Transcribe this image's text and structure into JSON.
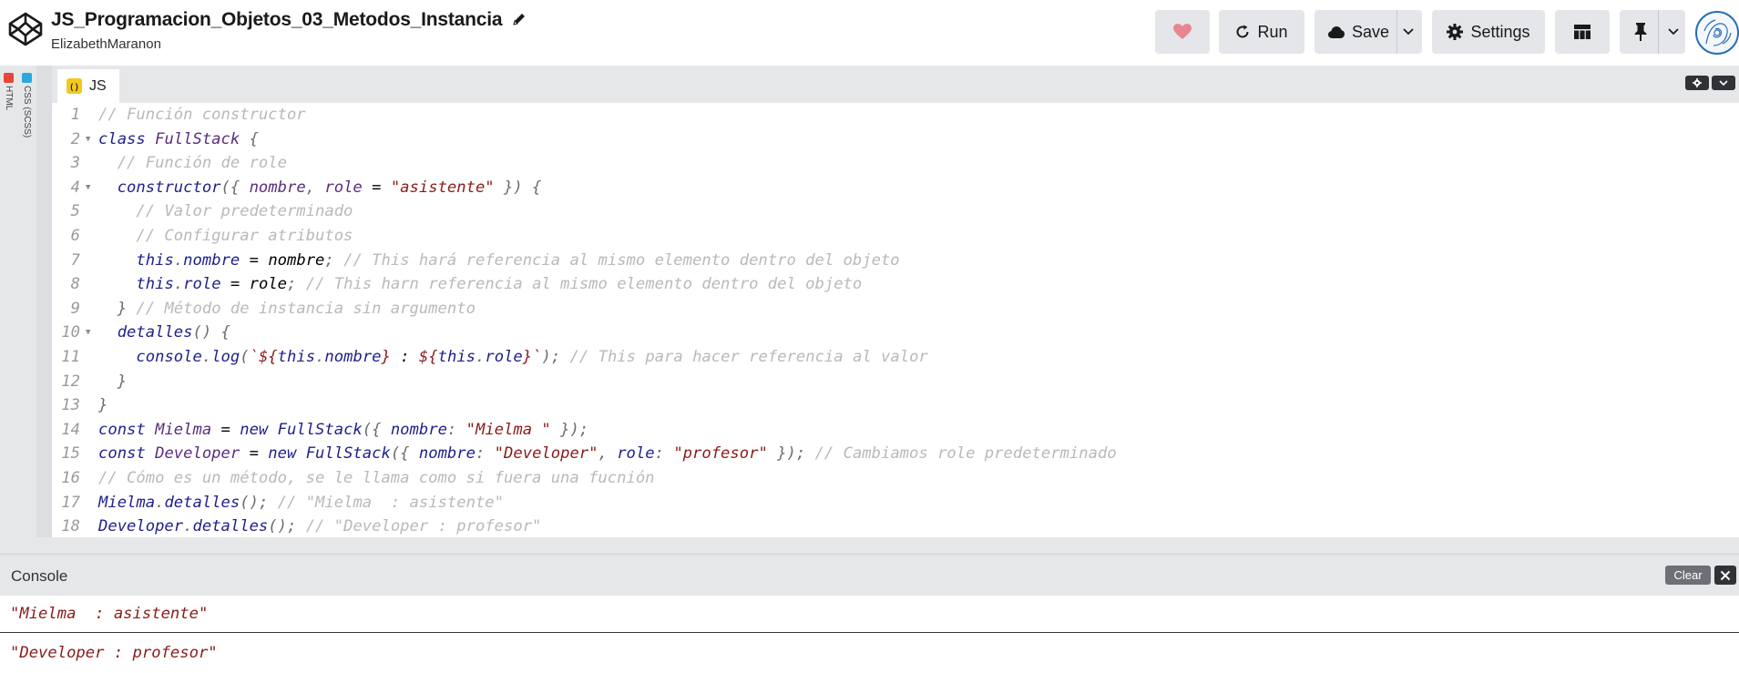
{
  "header": {
    "title": "JS_Programacion_Objetos_03_Metodos_Instancia",
    "author": "ElizabethMaranon",
    "run_label": "Run",
    "save_label": "Save",
    "settings_label": "Settings",
    "heart_color": "#e8868f"
  },
  "sidebar": {
    "html_label": "HTML",
    "css_label": "CSS (SCSS)"
  },
  "editor": {
    "tab_label": "JS",
    "line_numbers": [
      "1",
      "2",
      "3",
      "4",
      "5",
      "6",
      "7",
      "8",
      "9",
      "10",
      "11",
      "12",
      "13",
      "14",
      "15",
      "16",
      "17",
      "18"
    ],
    "lines": [
      [
        {
          "t": "// Función constructor",
          "c": "c"
        }
      ],
      [
        {
          "t": "class ",
          "c": "k"
        },
        {
          "t": "FullStack",
          "c": "n"
        },
        {
          "t": " {",
          "c": "p"
        }
      ],
      [
        {
          "t": "  // Función de role",
          "c": "c"
        }
      ],
      [
        {
          "t": "  ",
          "c": "p"
        },
        {
          "t": "constructor",
          "c": "k"
        },
        {
          "t": "({ ",
          "c": "p"
        },
        {
          "t": "nombre",
          "c": "n"
        },
        {
          "t": ", ",
          "c": "p"
        },
        {
          "t": "role",
          "c": "n"
        },
        {
          "t": " = ",
          "c": "d"
        },
        {
          "t": "\"asistente\"",
          "c": "s"
        },
        {
          "t": " }) {",
          "c": "p"
        }
      ],
      [
        {
          "t": "    // Valor predeterminado",
          "c": "c"
        }
      ],
      [
        {
          "t": "    // Configurar atributos",
          "c": "c"
        }
      ],
      [
        {
          "t": "    ",
          "c": "p"
        },
        {
          "t": "this",
          "c": "k"
        },
        {
          "t": ".",
          "c": "p"
        },
        {
          "t": "nombre",
          "c": "k"
        },
        {
          "t": " = ",
          "c": "d"
        },
        {
          "t": "nombre",
          "c": "d"
        },
        {
          "t": "; ",
          "c": "p"
        },
        {
          "t": "// This hará referencia al mismo elemento dentro del objeto",
          "c": "c"
        }
      ],
      [
        {
          "t": "    ",
          "c": "p"
        },
        {
          "t": "this",
          "c": "k"
        },
        {
          "t": ".",
          "c": "p"
        },
        {
          "t": "role",
          "c": "k"
        },
        {
          "t": " = ",
          "c": "d"
        },
        {
          "t": "role",
          "c": "d"
        },
        {
          "t": "; ",
          "c": "p"
        },
        {
          "t": "// This harn referencia al mismo elemento dentro del objeto",
          "c": "c"
        }
      ],
      [
        {
          "t": "  } ",
          "c": "p"
        },
        {
          "t": "// Método de instancia sin argumento",
          "c": "c"
        }
      ],
      [
        {
          "t": "  ",
          "c": "p"
        },
        {
          "t": "detalles",
          "c": "k"
        },
        {
          "t": "() {",
          "c": "p"
        }
      ],
      [
        {
          "t": "    ",
          "c": "p"
        },
        {
          "t": "console",
          "c": "k"
        },
        {
          "t": ".",
          "c": "p"
        },
        {
          "t": "log",
          "c": "k"
        },
        {
          "t": "(",
          "c": "p"
        },
        {
          "t": "`${",
          "c": "s"
        },
        {
          "t": "this",
          "c": "k"
        },
        {
          "t": ".",
          "c": "p"
        },
        {
          "t": "nombre",
          "c": "k"
        },
        {
          "t": "}",
          "c": "s"
        },
        {
          "t": " : ",
          "c": "d"
        },
        {
          "t": "${",
          "c": "s"
        },
        {
          "t": "this",
          "c": "k"
        },
        {
          "t": ".",
          "c": "p"
        },
        {
          "t": "role",
          "c": "k"
        },
        {
          "t": "}`",
          "c": "s"
        },
        {
          "t": "); ",
          "c": "p"
        },
        {
          "t": "// This para hacer referencia al valor",
          "c": "c"
        }
      ],
      [
        {
          "t": "  }",
          "c": "p"
        }
      ],
      [
        {
          "t": "}",
          "c": "p"
        }
      ],
      [
        {
          "t": "const ",
          "c": "k"
        },
        {
          "t": "Mielma",
          "c": "n"
        },
        {
          "t": " = ",
          "c": "d"
        },
        {
          "t": "new ",
          "c": "k"
        },
        {
          "t": "FullStack",
          "c": "k"
        },
        {
          "t": "({ ",
          "c": "p"
        },
        {
          "t": "nombre",
          "c": "k"
        },
        {
          "t": ": ",
          "c": "p"
        },
        {
          "t": "\"Mielma \"",
          "c": "s"
        },
        {
          "t": " });",
          "c": "p"
        }
      ],
      [
        {
          "t": "const ",
          "c": "k"
        },
        {
          "t": "Developer",
          "c": "n"
        },
        {
          "t": " = ",
          "c": "d"
        },
        {
          "t": "new ",
          "c": "k"
        },
        {
          "t": "FullStack",
          "c": "k"
        },
        {
          "t": "({ ",
          "c": "p"
        },
        {
          "t": "nombre",
          "c": "k"
        },
        {
          "t": ": ",
          "c": "p"
        },
        {
          "t": "\"Developer\"",
          "c": "s"
        },
        {
          "t": ", ",
          "c": "p"
        },
        {
          "t": "role",
          "c": "k"
        },
        {
          "t": ": ",
          "c": "p"
        },
        {
          "t": "\"profesor\"",
          "c": "s"
        },
        {
          "t": " }); ",
          "c": "p"
        },
        {
          "t": "// Cambiamos role predeterminado",
          "c": "c"
        }
      ],
      [
        {
          "t": "// Cómo es un método, se le llama como si fuera una fucnión",
          "c": "c"
        }
      ],
      [
        {
          "t": "Mielma",
          "c": "k"
        },
        {
          "t": ".",
          "c": "p"
        },
        {
          "t": "detalles",
          "c": "k"
        },
        {
          "t": "(); ",
          "c": "p"
        },
        {
          "t": "// \"Mielma  : asistente\"",
          "c": "c"
        }
      ],
      [
        {
          "t": "Developer",
          "c": "k"
        },
        {
          "t": ".",
          "c": "p"
        },
        {
          "t": "detalles",
          "c": "k"
        },
        {
          "t": "(); ",
          "c": "p"
        },
        {
          "t": "// \"Developer : profesor\"",
          "c": "c"
        }
      ]
    ]
  },
  "console": {
    "title": "Console",
    "clear_label": "Clear",
    "logs": [
      "\"Mielma  : asistente\"",
      "\"Developer : profesor\""
    ]
  }
}
